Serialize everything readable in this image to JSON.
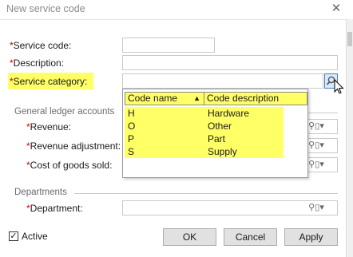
{
  "window": {
    "title": "New service code",
    "close_glyph": "✕"
  },
  "required_mark": "*",
  "fields": {
    "service_code": {
      "label": "Service code:",
      "value": ""
    },
    "description": {
      "label": "Description:",
      "value": ""
    },
    "service_category": {
      "label": "Service category:",
      "value": ""
    }
  },
  "general_ledger": {
    "heading": "General ledger accounts",
    "revenue": {
      "label": "Revenue:",
      "value": ""
    },
    "revenue_adjustment": {
      "label": "Revenue adjustment:",
      "value": ""
    },
    "cost_of_goods_sold": {
      "label": "Cost of goods sold:",
      "value": ""
    }
  },
  "departments": {
    "heading": "Departments",
    "department": {
      "label": "Department:",
      "value": ""
    }
  },
  "dropdown": {
    "columns": [
      "Code name",
      "Code description"
    ],
    "sort_glyph": "▲",
    "rows": [
      {
        "code": "H",
        "description": "Hardware"
      },
      {
        "code": "O",
        "description": "Other"
      },
      {
        "code": "P",
        "description": "Part"
      },
      {
        "code": "S",
        "description": "Supply"
      }
    ]
  },
  "active": {
    "label": "Active",
    "checked": true,
    "check_glyph": "✓"
  },
  "buttons": {
    "ok": "OK",
    "cancel": "Cancel",
    "apply": "Apply"
  },
  "icons": {
    "search": "search-icon",
    "book": "book-icon",
    "dropdown_arrow": "▾"
  },
  "colors": {
    "highlight": "#ffff66",
    "required": "#d40000"
  }
}
